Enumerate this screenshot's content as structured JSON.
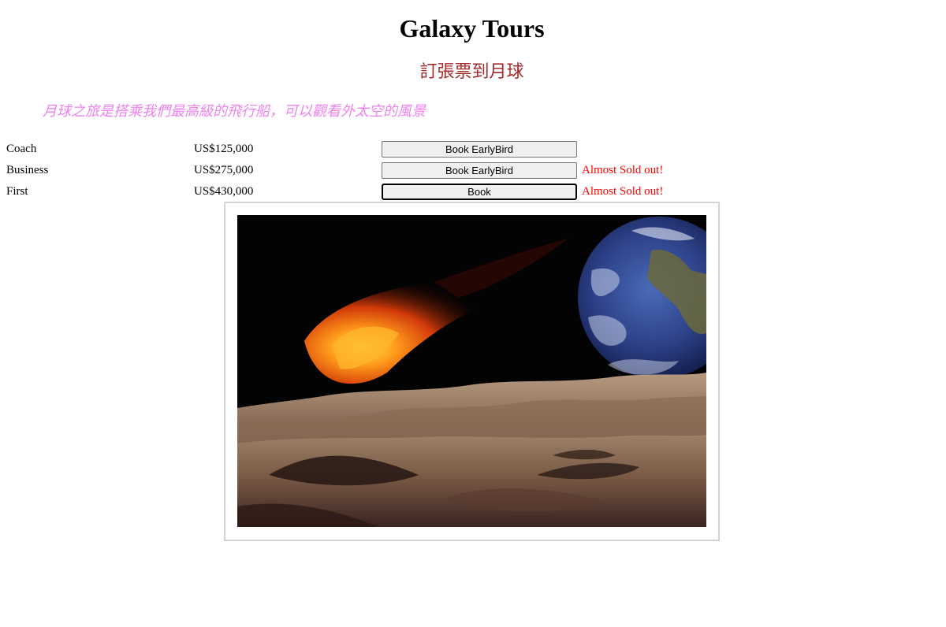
{
  "header": {
    "title": "Galaxy Tours",
    "subtitle": "訂張票到月球",
    "tagline": "月球之旅是搭乘我們最高級的飛行船，可以觀看外太空的風景"
  },
  "fares": [
    {
      "class": "Coach",
      "price": "US$125,000",
      "button": "Book EarlyBird",
      "note": ""
    },
    {
      "class": "Business",
      "price": "US$275,000",
      "button": "Book EarlyBird",
      "note": "Almost Sold out!"
    },
    {
      "class": "First",
      "price": "US$430,000",
      "button": "Book",
      "note": "Almost Sold out!"
    }
  ],
  "colors": {
    "subtitle": "#a52a2a",
    "tagline": "#ee82ee",
    "note": "#ff0000"
  }
}
